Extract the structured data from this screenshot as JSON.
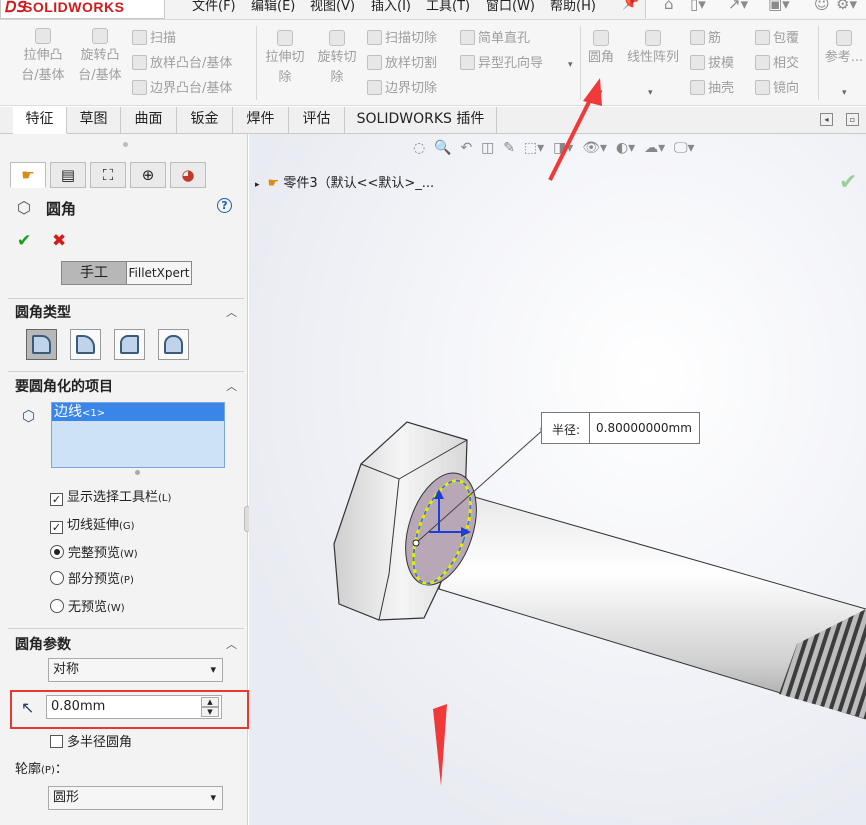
{
  "app": {
    "brand": "SOLIDWORKS"
  },
  "menubar": [
    "文件(F)",
    "编辑(E)",
    "视图(V)",
    "插入(I)",
    "工具(T)",
    "窗口(W)",
    "帮助(H)"
  ],
  "commands": {
    "extrude_boss": "拉伸凸台/基体",
    "revolve_boss": "旋转凸台/基体",
    "sweep": "扫描",
    "loft": "放样凸台/基体",
    "boundary_boss": "边界凸台/基体",
    "extrude_cut": "拉伸切除",
    "revolve_cut": "旋转切除",
    "swept_cut": "扫描切除",
    "lofted_cut": "放样切割",
    "boundary_cut": "边界切除",
    "simple_hole": "简单直孔",
    "hole_wizard": "异型孔向导",
    "fillet": "圆角",
    "linear_pattern": "线性阵列",
    "rib": "筋",
    "draft": "拔模",
    "shell": "抽壳",
    "wrap": "包覆",
    "intersect": "相交",
    "mirror": "镜向",
    "reference": "参考..."
  },
  "tabs": [
    "特征",
    "草图",
    "曲面",
    "钣金",
    "焊件",
    "评估",
    "SOLIDWORKS 插件"
  ],
  "property_manager": {
    "title": "圆角",
    "manual": "手工",
    "filletxpert": "FilletXpert",
    "fillet_type": {
      "heading": "圆角类型"
    },
    "items": {
      "heading": "要圆角化的项目",
      "selected": "边线",
      "selected_suffix": "<1>"
    },
    "options": {
      "show_toolbar": "显示选择工具栏",
      "show_toolbar_key": "(L)",
      "tangent": "切线延伸",
      "tangent_key": "(G)",
      "full_preview": "完整预览",
      "full_preview_key": "(W)",
      "partial_preview": "部分预览",
      "partial_preview_key": "(P)",
      "no_preview": "无预览",
      "no_preview_key": "(W)"
    },
    "params": {
      "heading": "圆角参数",
      "method": "对称",
      "radius": "0.80mm",
      "multi_radius": "多半径圆角",
      "profile_label": "轮廓",
      "profile_key": "(P)",
      "profile_colon": "：",
      "profile": "圆形"
    }
  },
  "graphics": {
    "tree_item": "零件3（默认<<默认>_...",
    "callout_label": "半径:",
    "callout_value": "0.80000000mm"
  },
  "colors": {
    "accent_red": "#e8392f",
    "highlight": "#e8e800",
    "select_blue": "#3a73ff"
  }
}
